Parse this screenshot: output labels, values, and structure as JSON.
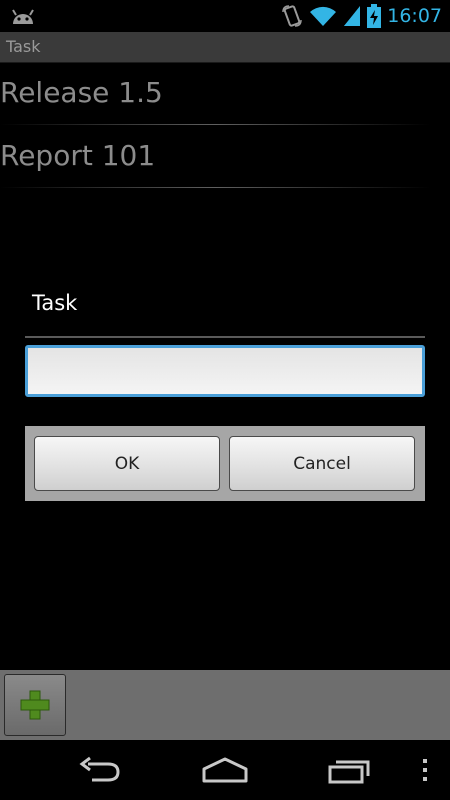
{
  "status_bar": {
    "time": "16:07",
    "icons": [
      "android-icon",
      "rotate-icon",
      "wifi-icon",
      "signal-icon",
      "battery-charging-icon"
    ]
  },
  "title_bar": {
    "title": "Task"
  },
  "task_list": [
    {
      "label": "Release 1.5"
    },
    {
      "label": "Report 101"
    }
  ],
  "dialog": {
    "title": "Task",
    "input": {
      "value": "",
      "placeholder": ""
    },
    "ok_label": "OK",
    "cancel_label": "Cancel"
  },
  "bottom_bar": {
    "add_icon": "plus-icon",
    "accent_color": "#4f8a1e"
  },
  "nav_bar": {
    "icons": [
      "back-icon",
      "home-icon",
      "recent-apps-icon",
      "overflow-menu-icon"
    ]
  }
}
